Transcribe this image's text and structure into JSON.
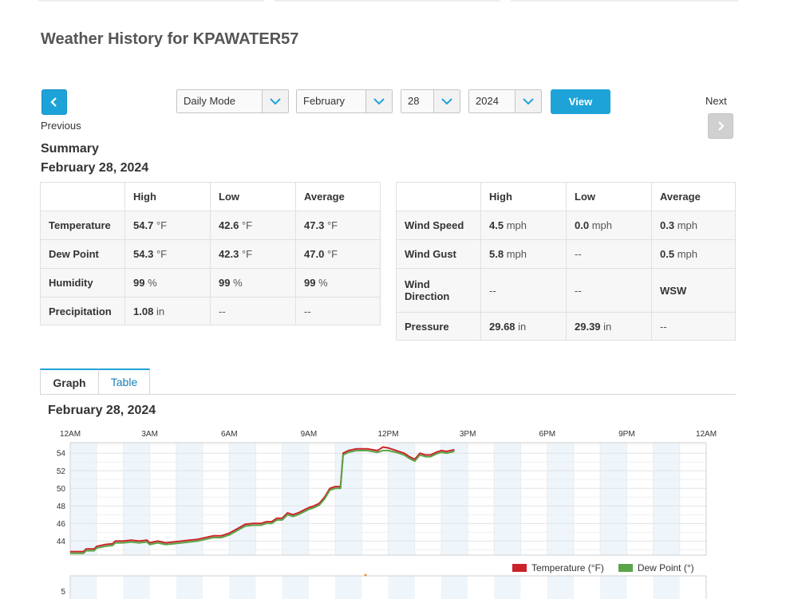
{
  "page": {
    "title": "Weather History for KPAWATER57"
  },
  "nav": {
    "previous_label": "Previous",
    "next_label": "Next",
    "mode": "Daily Mode",
    "month": "February",
    "day": "28",
    "year": "2024",
    "view_label": "View"
  },
  "summary": {
    "heading": "Summary",
    "date": "February 28, 2024"
  },
  "table_left": {
    "headers": [
      "",
      "High",
      "Low",
      "Average"
    ],
    "rows": [
      {
        "label": "Temperature",
        "high": "54.7",
        "high_unit": "°F",
        "low": "42.6",
        "low_unit": "°F",
        "avg": "47.3",
        "avg_unit": "°F"
      },
      {
        "label": "Dew Point",
        "high": "54.3",
        "high_unit": "°F",
        "low": "42.3",
        "low_unit": "°F",
        "avg": "47.0",
        "avg_unit": "°F"
      },
      {
        "label": "Humidity",
        "high": "99",
        "high_unit": "%",
        "low": "99",
        "low_unit": "%",
        "avg": "99",
        "avg_unit": "%"
      },
      {
        "label": "Precipitation",
        "high": "1.08",
        "high_unit": "in",
        "low": "--",
        "low_unit": "",
        "avg": "--",
        "avg_unit": ""
      }
    ]
  },
  "table_right": {
    "headers": [
      "",
      "High",
      "Low",
      "Average"
    ],
    "rows": [
      {
        "label": "Wind Speed",
        "high": "4.5",
        "high_unit": "mph",
        "low": "0.0",
        "low_unit": "mph",
        "avg": "0.3",
        "avg_unit": "mph"
      },
      {
        "label": "Wind Gust",
        "high": "5.8",
        "high_unit": "mph",
        "low": "--",
        "low_unit": "",
        "avg": "0.5",
        "avg_unit": "mph"
      },
      {
        "label": "Wind Direction",
        "high": "--",
        "high_unit": "",
        "low": "--",
        "low_unit": "",
        "avg": "WSW",
        "avg_unit": ""
      },
      {
        "label": "Pressure",
        "high": "29.68",
        "high_unit": "in",
        "low": "29.39",
        "low_unit": "in",
        "avg": "--",
        "avg_unit": ""
      }
    ]
  },
  "tabs": {
    "graph": "Graph",
    "table": "Table"
  },
  "graph": {
    "date": "February 28, 2024"
  },
  "chart_data": {
    "type": "line",
    "x_labels": [
      "12AM",
      "3AM",
      "6AM",
      "9AM",
      "12PM",
      "3PM",
      "6PM",
      "9PM",
      "12AM"
    ],
    "y_ticks": [
      44,
      46,
      48,
      50,
      52,
      54
    ],
    "ylim": [
      42.4,
      55.2
    ],
    "xlim_hours": [
      0,
      24
    ],
    "second_panel_tick": "5",
    "series": [
      {
        "name": "Temperature (°F)",
        "color": "#cc2229",
        "x": [
          0,
          0.5,
          0.6,
          0.9,
          1.0,
          1.3,
          1.6,
          1.7,
          2.0,
          2.3,
          2.6,
          2.9,
          3.0,
          3.3,
          3.6,
          3.9,
          4.2,
          4.5,
          4.8,
          5.1,
          5.4,
          5.7,
          6.0,
          6.3,
          6.6,
          6.9,
          7.2,
          7.4,
          7.6,
          7.8,
          8.0,
          8.2,
          8.4,
          8.6,
          8.8,
          9.0,
          9.2,
          9.4,
          9.6,
          9.8,
          10.0,
          10.2,
          10.3,
          10.5,
          10.8,
          11.2,
          11.6,
          11.8,
          12.0,
          12.3,
          12.6,
          12.8,
          13.0,
          13.2,
          13.4,
          13.6,
          13.8,
          14.0,
          14.2,
          14.5
        ],
        "y": [
          42.8,
          42.8,
          43.1,
          43.1,
          43.4,
          43.6,
          43.7,
          44.0,
          44.0,
          44.1,
          44.0,
          44.1,
          43.8,
          44.0,
          43.8,
          43.9,
          44.0,
          44.1,
          44.2,
          44.4,
          44.6,
          44.6,
          44.9,
          45.4,
          45.9,
          46.0,
          46.0,
          46.2,
          46.2,
          46.6,
          46.6,
          47.2,
          47.0,
          47.2,
          47.5,
          47.8,
          48.0,
          48.3,
          49.0,
          50.0,
          50.2,
          50.2,
          54.0,
          54.3,
          54.5,
          54.5,
          54.3,
          54.7,
          54.6,
          54.3,
          54.0,
          53.6,
          53.3,
          54.0,
          53.8,
          53.8,
          54.1,
          54.3,
          54.2,
          54.4
        ]
      },
      {
        "name": "Dew Point (°)",
        "color": "#5aa547",
        "x": [
          0,
          0.5,
          0.6,
          0.9,
          1.0,
          1.3,
          1.6,
          1.7,
          2.0,
          2.3,
          2.6,
          2.9,
          3.0,
          3.3,
          3.6,
          3.9,
          4.2,
          4.5,
          4.8,
          5.1,
          5.4,
          5.7,
          6.0,
          6.3,
          6.6,
          6.9,
          7.2,
          7.4,
          7.6,
          7.8,
          8.0,
          8.2,
          8.4,
          8.6,
          8.8,
          9.0,
          9.2,
          9.4,
          9.6,
          9.8,
          10.0,
          10.2,
          10.3,
          10.5,
          10.8,
          11.2,
          11.6,
          11.8,
          12.0,
          12.3,
          12.6,
          12.8,
          13.0,
          13.2,
          13.4,
          13.6,
          13.8,
          14.0,
          14.2,
          14.5
        ],
        "y": [
          42.6,
          42.6,
          42.9,
          42.9,
          43.2,
          43.4,
          43.5,
          43.8,
          43.8,
          43.9,
          43.8,
          43.9,
          43.6,
          43.8,
          43.6,
          43.7,
          43.8,
          43.9,
          44.0,
          44.2,
          44.4,
          44.4,
          44.7,
          45.2,
          45.7,
          45.8,
          45.8,
          46.0,
          46.0,
          46.4,
          46.4,
          47.0,
          46.8,
          47.0,
          47.3,
          47.6,
          47.8,
          48.1,
          48.8,
          49.8,
          50.0,
          50.0,
          53.8,
          54.1,
          54.3,
          54.3,
          54.1,
          54.3,
          54.3,
          54.1,
          53.8,
          53.4,
          53.1,
          53.8,
          53.6,
          53.6,
          53.9,
          54.1,
          54.0,
          54.2
        ]
      }
    ]
  }
}
